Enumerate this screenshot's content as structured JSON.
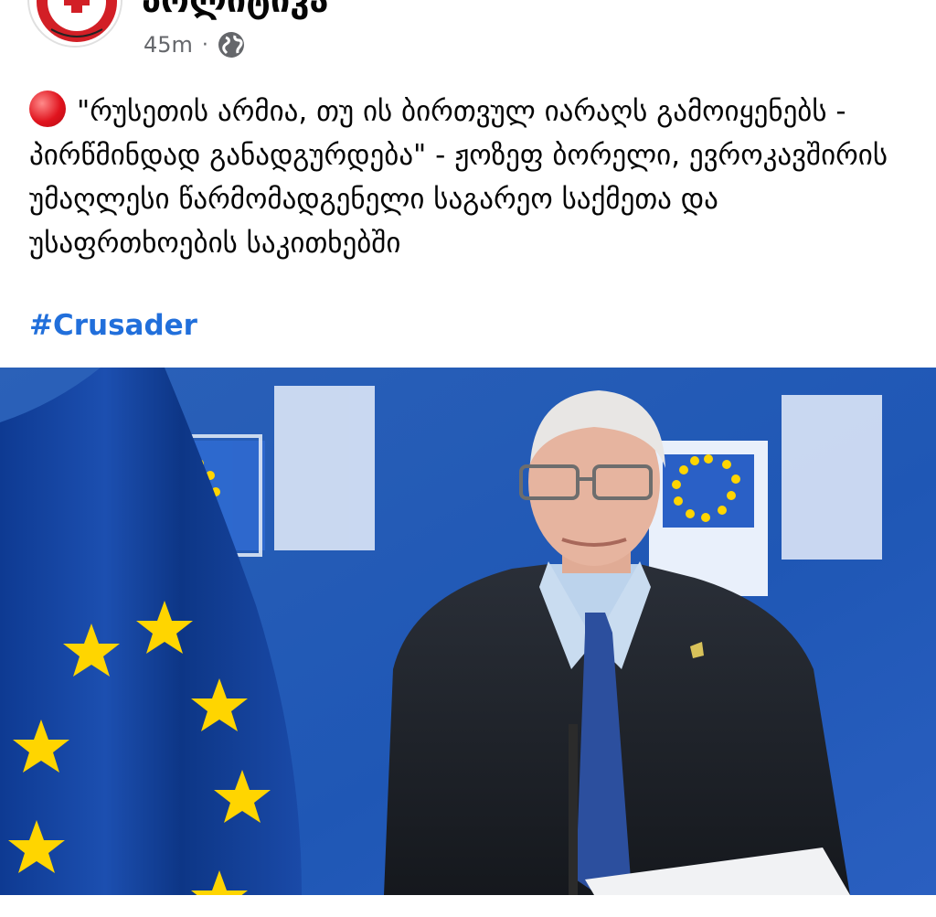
{
  "page": {
    "name": "პოლიტიკა",
    "time": "45m",
    "separator": "·",
    "privacy_icon": "globe-icon"
  },
  "post": {
    "emoji": "red-circle-icon",
    "text": "\"რუსეთის არმია, თუ ის ბირთვულ იარაღს გამოიყენებს - პირწმინდად განადგურდება\" - ჟოზეფ ბორელი, ევროკავშირის უმაღლესი წარმომადგენელი საგარეო საქმეთა და უსაფრთხოების საკითხებში",
    "hashtag": "#Crusader"
  },
  "colors": {
    "hashtag": "#216fdb",
    "eu_blue": "#1f4fa8",
    "eu_star": "#ffd500"
  }
}
